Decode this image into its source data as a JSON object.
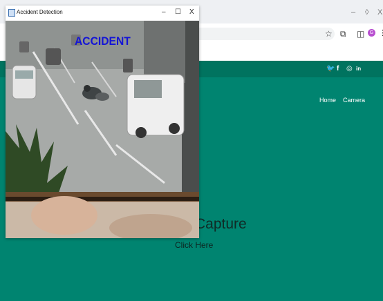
{
  "browser": {
    "controls": {
      "minimize": "–",
      "restore": "◊",
      "close": "X"
    },
    "toolbar_icons": [
      "star-icon",
      "extensions-icon",
      "sidepanel-icon",
      "profile-icon",
      "menu-icon"
    ],
    "bookmark_star": "☆",
    "extensions": "⧉",
    "sidepanel": "◫",
    "profile_initial": "G",
    "menu": "⋮"
  },
  "site": {
    "social_icons": [
      "twitter-icon",
      "facebook-icon",
      "instagram-icon",
      "linkedin-icon"
    ],
    "twitter": "🐦",
    "facebook": "f",
    "instagram": "◎",
    "linkedin": "in",
    "nav": [
      {
        "label": "Home"
      },
      {
        "label": "Camera"
      }
    ],
    "heading": "Capture",
    "cta": "Click Here",
    "colors": {
      "teal": "#008470",
      "band": "#00735f"
    }
  },
  "overlay_window": {
    "title": "Accident Detection",
    "controls": {
      "minimize": "–",
      "maximize": "☐",
      "close": "X"
    },
    "frame_label": "ACCIDENT",
    "label_color": "#1414d6"
  }
}
